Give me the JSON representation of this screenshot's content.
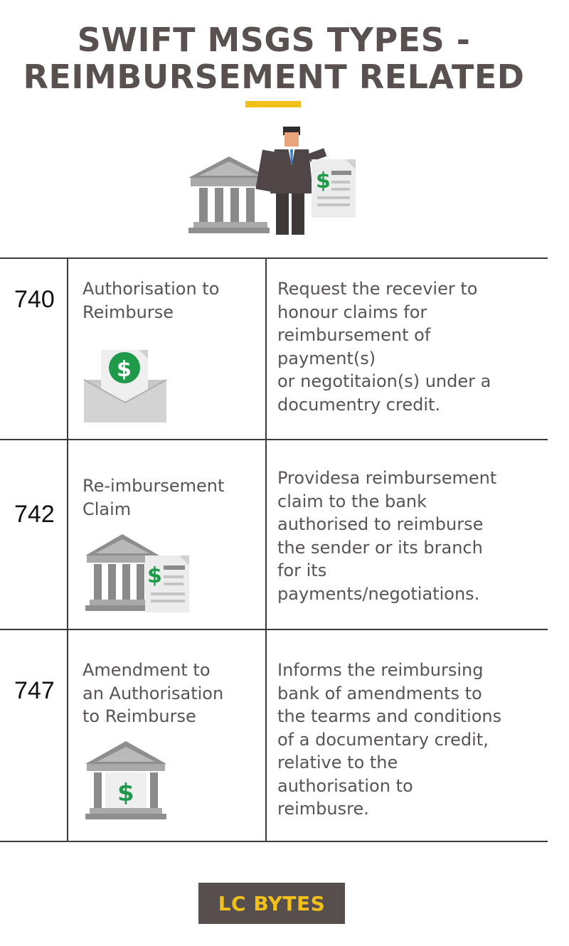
{
  "header": {
    "title_line1": "SWIFT MSGS TYPES -",
    "title_line2": "REIMBURSEMENT RELATED"
  },
  "colors": {
    "accent": "#f2c01a",
    "text": "#5a5254",
    "dollar_green": "#1e9a4a",
    "icon_gray": "#9a9a9a"
  },
  "rows": [
    {
      "code": "740",
      "name": [
        "Authorisation to",
        "Reimburse"
      ],
      "description": [
        "Request the recevier to",
        "honour claims for",
        "reimbursement of",
        "payment(s)",
        "or negotitaion(s) under a",
        "documentry credit."
      ],
      "icon": "envelope-dollar-icon"
    },
    {
      "code": "742",
      "name": [
        "Re-imbursement",
        "Claim"
      ],
      "description": [
        "Providesa reimbursement",
        "claim to the bank",
        "authorised to reimburse",
        "the sender or its branch",
        "for its",
        "payments/negotiations."
      ],
      "icon": "bank-invoice-icon"
    },
    {
      "code": "747",
      "name": [
        "Amendment to",
        "an Authorisation",
        "to Reimburse"
      ],
      "description": [
        "Informs the reimbursing",
        "bank of amendments to",
        "the tearms and conditions",
        "of a documentary credit,",
        "relative to the",
        "authorisation to",
        "reimbusre."
      ],
      "icon": "bank-dollar-icon"
    }
  ],
  "footer": {
    "badge_label": "LC BYTES"
  }
}
